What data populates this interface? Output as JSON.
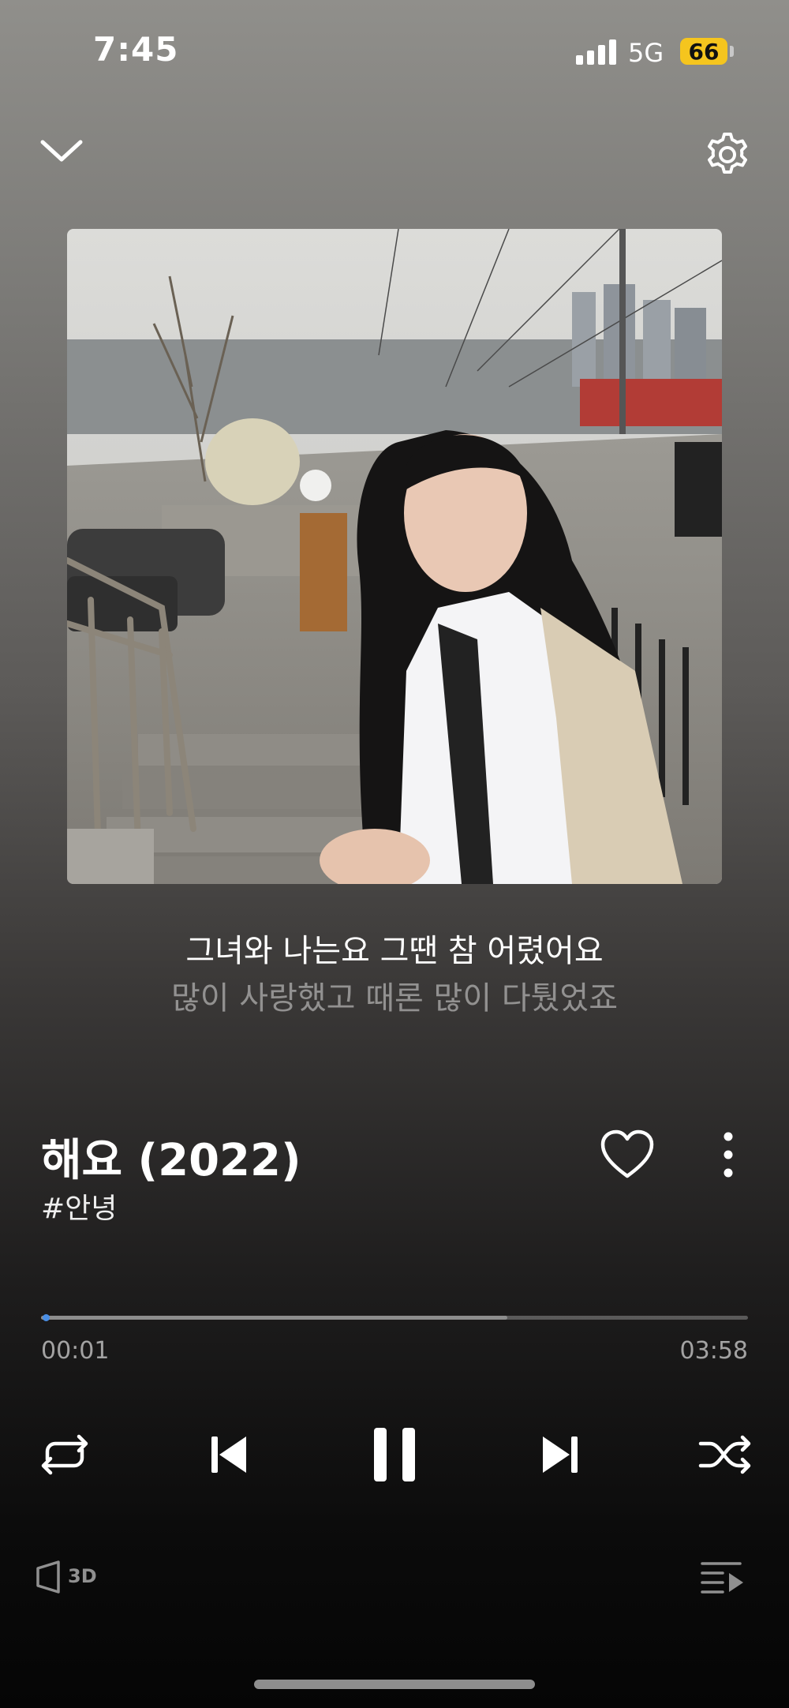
{
  "status_bar": {
    "time": "7:45",
    "network": "5G",
    "battery": "66",
    "battery_color": "#f5c51e"
  },
  "top_bar": {
    "collapse_icon": "chevron-down-icon",
    "settings_icon": "gear-icon"
  },
  "album_art": {
    "description_icon": "album-cover-image"
  },
  "lyrics": {
    "current": "그녀와 나는요 그땐 참 어렸어요",
    "next": "많이 사랑했고 때론 많이 다퉜었죠"
  },
  "track": {
    "title": "해요 (2022)",
    "tag": "#안녕",
    "like_icon": "heart-outline-icon",
    "more_icon": "vertical-dots-icon"
  },
  "progress": {
    "elapsed": "00:01",
    "total": "03:58",
    "buffered_fraction": 0.66,
    "played_fraction": 0.004,
    "accent_color": "#4a8fe6"
  },
  "controls": {
    "repeat_icon": "repeat-icon",
    "prev_icon": "skip-previous-icon",
    "pause_icon": "pause-icon",
    "next_icon": "skip-next-icon",
    "shuffle_icon": "shuffle-icon"
  },
  "bottom_bar": {
    "audio_3d_label": "3D",
    "audio_3d_icon": "speaker-3d-icon",
    "playlist_icon": "playlist-icon"
  }
}
